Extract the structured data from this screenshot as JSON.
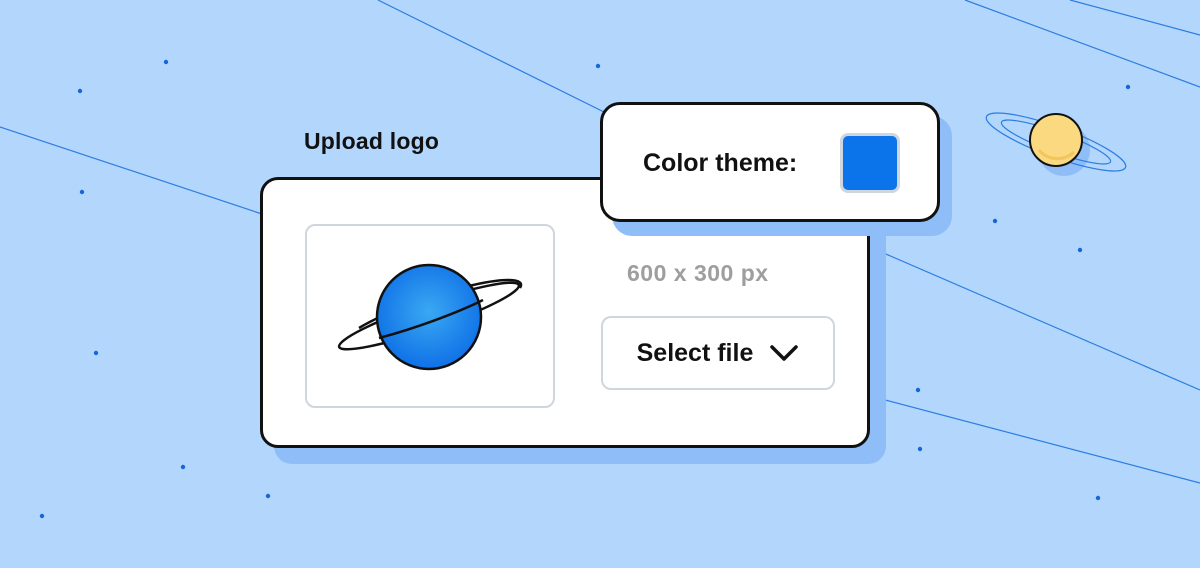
{
  "upload": {
    "title": "Upload logo",
    "dimensions": "600 x 300 px",
    "select_label": "Select file",
    "icons": {
      "preview": "planet-icon",
      "dropdown": "chevron-down-icon"
    }
  },
  "theme": {
    "label": "Color theme:",
    "selected_color": "#0b74ea"
  },
  "colors": {
    "background": "#b3d6fd",
    "accent": "#0b74ea",
    "border": "#111111",
    "muted_text": "#9e9e9e"
  }
}
